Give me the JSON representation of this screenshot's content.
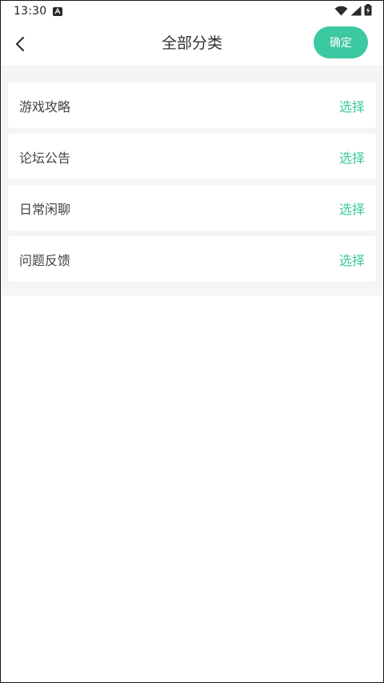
{
  "status_bar": {
    "time": "13:30"
  },
  "header": {
    "title": "全部分类",
    "confirm_label": "确定"
  },
  "categories": [
    {
      "name": "游戏攻略",
      "action": "选择"
    },
    {
      "name": "论坛公告",
      "action": "选择"
    },
    {
      "name": "日常闲聊",
      "action": "选择"
    },
    {
      "name": "问题反馈",
      "action": "选择"
    }
  ],
  "colors": {
    "accent": "#3cc8a0",
    "background": "#f5f5f5",
    "title_text": "#333333"
  },
  "icons": [
    "notification-a-icon",
    "wifi-icon",
    "signal-icon",
    "battery-icon",
    "back-arrow-icon"
  ]
}
